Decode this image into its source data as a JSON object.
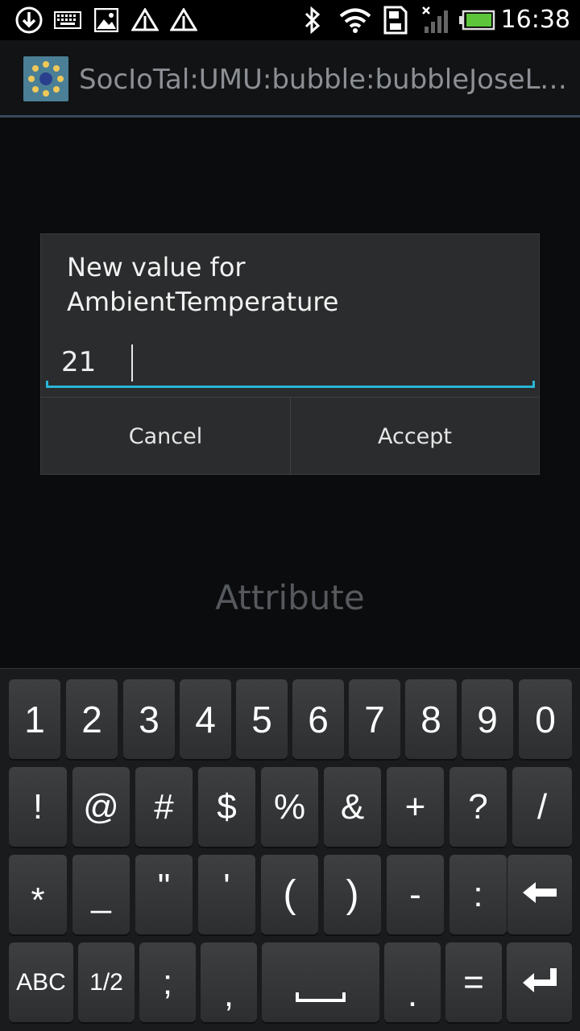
{
  "status_bar": {
    "time": "16:38",
    "icons": [
      "download-icon",
      "keyboard-icon",
      "gallery-icon",
      "recycle-icon",
      "recycle-icon",
      "bluetooth-icon",
      "wifi-icon",
      "sd-card-icon",
      "signal-icon",
      "battery-icon"
    ]
  },
  "action_bar": {
    "title": "SocIoTal:UMU:bubble:bubbleJoseLu..."
  },
  "background": {
    "label": "Attribute"
  },
  "dialog": {
    "title": "New value for AmbientTemperature",
    "input_value": "21",
    "cancel_label": "Cancel",
    "accept_label": "Accept",
    "accent_color": "#29b6d6"
  },
  "keyboard": {
    "row1": [
      "1",
      "2",
      "3",
      "4",
      "5",
      "6",
      "7",
      "8",
      "9",
      "0"
    ],
    "row2": [
      "!",
      "@",
      "#",
      "$",
      "%",
      "&",
      "+",
      "?",
      "/"
    ],
    "row3": [
      "*",
      "_",
      "\"",
      "'",
      "(",
      ")",
      "-",
      ":"
    ],
    "row4": [
      "ABC",
      "1/2",
      ";",
      ",",
      ".",
      "="
    ],
    "backspace_icon": "backspace-icon",
    "enter_icon": "enter-icon",
    "space_icon": "space-icon"
  }
}
